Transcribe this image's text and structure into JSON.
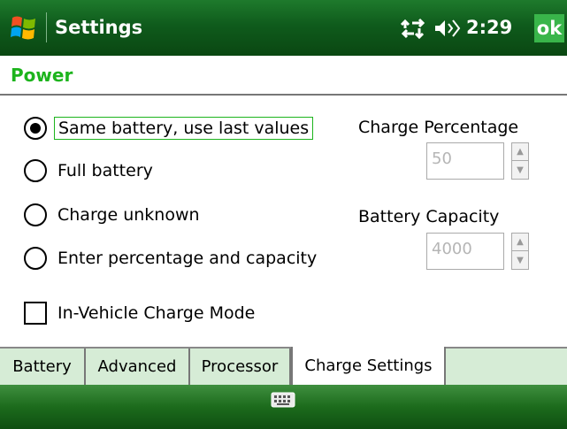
{
  "title_bar": {
    "title": "Settings",
    "time": "2:29",
    "ok_label": "ok",
    "icons": [
      "windows-start-icon",
      "connectivity-icon",
      "volume-icon"
    ]
  },
  "section": {
    "title": "Power"
  },
  "radios": [
    {
      "label": "Same battery, use last values",
      "selected": true
    },
    {
      "label": "Full battery",
      "selected": false
    },
    {
      "label": "Charge unknown",
      "selected": false
    },
    {
      "label": "Enter percentage and capacity",
      "selected": false
    }
  ],
  "charge_percentage": {
    "label": "Charge Percentage",
    "value": "50",
    "enabled": false
  },
  "battery_capacity": {
    "label": "Battery Capacity",
    "value": "4000",
    "enabled": false
  },
  "checkbox": {
    "label": "In-Vehicle Charge Mode",
    "checked": false
  },
  "tabs": [
    {
      "label": "Battery",
      "active": false
    },
    {
      "label": "Advanced",
      "active": false
    },
    {
      "label": "Processor",
      "active": false
    },
    {
      "label": "Charge Settings",
      "active": true
    }
  ],
  "bottom_bar": {
    "icon": "keyboard-icon"
  },
  "colors": {
    "title_bar": "#0f5b1c",
    "accent": "#1db41d",
    "ok_button": "#39b54a",
    "tab_strip": "#d6ecd6"
  }
}
